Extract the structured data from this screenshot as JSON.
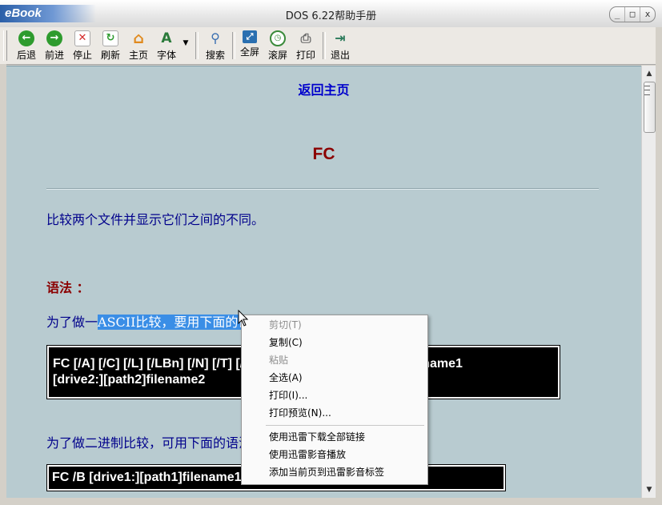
{
  "window": {
    "brand": "eBook",
    "title": "DOS  6.22帮助手册",
    "controls": {
      "minimize": "_",
      "maximize": "□",
      "close": "x"
    }
  },
  "toolbar": {
    "back": {
      "label": "后退",
      "icon": "back-arrow-icon",
      "color": "#2e9b2e"
    },
    "forward": {
      "label": "前进",
      "icon": "forward-arrow-icon",
      "color": "#2e9b2e"
    },
    "stop": {
      "label": "停止",
      "icon": "stop-icon",
      "color": "#d42a2a"
    },
    "refresh": {
      "label": "刷新",
      "icon": "refresh-icon",
      "color": "#2e9b2e"
    },
    "home": {
      "label": "主页",
      "icon": "home-icon",
      "color": "#e08a1e"
    },
    "font": {
      "label": "字体",
      "icon": "font-icon",
      "color": "#2a7a3a"
    },
    "search": {
      "label": "搜索",
      "icon": "magnifier-icon",
      "color": "#3a6fb0"
    },
    "fullscreen": {
      "label": "全屏",
      "icon": "fullscreen-icon",
      "color": "#2a6fb0"
    },
    "scroll": {
      "label": "滚屏",
      "icon": "clock-icon",
      "color": "#3a8a3a"
    },
    "print": {
      "label": "打印",
      "icon": "printer-icon",
      "color": "#6a6a6a"
    },
    "exit": {
      "label": "退出",
      "icon": "exit-icon",
      "color": "#2a7a5a"
    }
  },
  "content": {
    "home_link": "返回主页",
    "page_title": "FC",
    "description": "比较两个文件并显示它们之间的不同。",
    "syntax_label": "语法 ：",
    "ascii_prefix": "为了做一",
    "ascii_highlight": "ASCII比较，要用下面的语法：",
    "code1_line1": "FC [/A] [/C] [/L] [/LBn] [/N] [/T] [/W] [/nnnn] [drive1:][path1]filename1",
    "code1_line2": "[drive2:][path2]filename2",
    "binary_text": "为了做二进制比较，可用下面的语法：",
    "code2": "FC /B [drive1:][path1]filename1 [drive2:][path2]filename2"
  },
  "context_menu": {
    "cut": "剪切(T)",
    "copy": "复制(C)",
    "paste": "粘贴",
    "select_all": "全选(A)",
    "print": "打印(I)...",
    "print_preview": "打印预览(N)...",
    "thunder_download_all": "使用迅雷下载全部链接",
    "thunder_play": "使用迅雷影音播放",
    "thunder_bookmark": "添加当前页到迅雷影音标签"
  },
  "colors": {
    "content_bg": "#b8cbd0",
    "link": "#0000cc",
    "title": "#8b0000",
    "text": "#00008b",
    "selection": "#3a8ee6"
  }
}
